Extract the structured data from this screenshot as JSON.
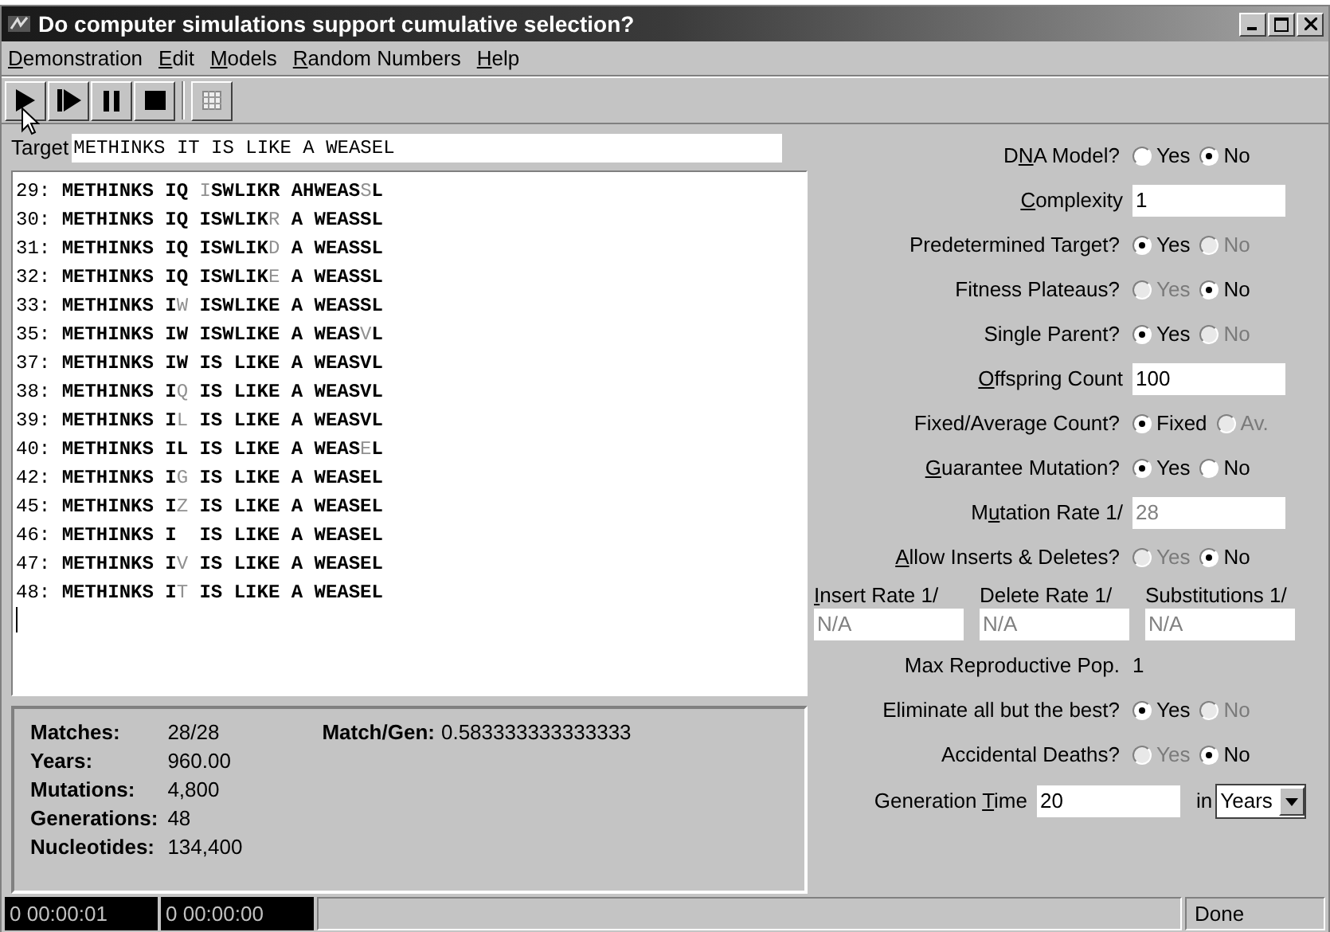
{
  "window": {
    "title": "Do computer simulations support cumulative selection?"
  },
  "menu": [
    {
      "label": [
        {
          "text": "D",
          "underline": true
        },
        {
          "text": "emonstration",
          "underline": false
        }
      ]
    },
    {
      "label": [
        {
          "text": "E",
          "underline": true
        },
        {
          "text": "dit",
          "underline": false
        }
      ]
    },
    {
      "label": [
        {
          "text": "M",
          "underline": true
        },
        {
          "text": "odels",
          "underline": false
        }
      ]
    },
    {
      "label": [
        {
          "text": "R",
          "underline": true
        },
        {
          "text": "andom Numbers",
          "underline": false
        }
      ]
    },
    {
      "label": [
        {
          "text": "H",
          "underline": true
        },
        {
          "text": "elp",
          "underline": false
        }
      ]
    }
  ],
  "toolbar": [
    {
      "kind": "play"
    },
    {
      "kind": "step"
    },
    {
      "kind": "pause"
    },
    {
      "kind": "stop"
    },
    {
      "kind": "grid"
    }
  ],
  "target": {
    "label": "Target",
    "value": "METHINKS IT IS LIKE A WEASEL"
  },
  "output": [
    {
      "number": "29:",
      "segments": [
        {
          "text": "METHINKS IQ ",
          "changed": false
        },
        {
          "text": "I",
          "changed": true
        },
        {
          "text": "SWLIKR AHWEAS",
          "changed": false
        },
        {
          "text": "S",
          "changed": true
        },
        {
          "text": "L",
          "changed": false
        }
      ]
    },
    {
      "number": "30:",
      "segments": [
        {
          "text": "METHINKS IQ ISWLIK",
          "changed": false
        },
        {
          "text": "R",
          "changed": true
        },
        {
          "text": " A WEASSL",
          "changed": false
        }
      ]
    },
    {
      "number": "31:",
      "segments": [
        {
          "text": "METHINKS IQ ISWLIK",
          "changed": false
        },
        {
          "text": "D",
          "changed": true
        },
        {
          "text": " A WEASSL",
          "changed": false
        }
      ]
    },
    {
      "number": "32:",
      "segments": [
        {
          "text": "METHINKS IQ ISWLIK",
          "changed": false
        },
        {
          "text": "E",
          "changed": true
        },
        {
          "text": " A WEASSL",
          "changed": false
        }
      ]
    },
    {
      "number": "33:",
      "segments": [
        {
          "text": "METHINKS I",
          "changed": false
        },
        {
          "text": "W",
          "changed": true
        },
        {
          "text": " ISWLIKE A WEASSL",
          "changed": false
        }
      ]
    },
    {
      "number": "35:",
      "segments": [
        {
          "text": "METHINKS IW ISWLIKE A WEAS",
          "changed": false
        },
        {
          "text": "V",
          "changed": true
        },
        {
          "text": "L",
          "changed": false
        }
      ]
    },
    {
      "number": "37:",
      "segments": [
        {
          "text": "METHINKS IW IS LIKE A WEASVL",
          "changed": false
        }
      ]
    },
    {
      "number": "38:",
      "segments": [
        {
          "text": "METHINKS I",
          "changed": false
        },
        {
          "text": "Q",
          "changed": true
        },
        {
          "text": " IS LIKE A WEASVL",
          "changed": false
        }
      ]
    },
    {
      "number": "39:",
      "segments": [
        {
          "text": "METHINKS I",
          "changed": false
        },
        {
          "text": "L",
          "changed": true
        },
        {
          "text": " IS LIKE A WEASVL",
          "changed": false
        }
      ]
    },
    {
      "number": "40:",
      "segments": [
        {
          "text": "METHINKS IL IS LIKE A WEAS",
          "changed": false
        },
        {
          "text": "E",
          "changed": true
        },
        {
          "text": "L",
          "changed": false
        }
      ]
    },
    {
      "number": "42:",
      "segments": [
        {
          "text": "METHINKS I",
          "changed": false
        },
        {
          "text": "G",
          "changed": true
        },
        {
          "text": " IS LIKE A WEASEL",
          "changed": false
        }
      ]
    },
    {
      "number": "45:",
      "segments": [
        {
          "text": "METHINKS I",
          "changed": false
        },
        {
          "text": "Z",
          "changed": true
        },
        {
          "text": " IS LIKE A WEASEL",
          "changed": false
        }
      ]
    },
    {
      "number": "46:",
      "segments": [
        {
          "text": "METHINKS I  IS LIKE A WEASEL",
          "changed": false
        }
      ]
    },
    {
      "number": "47:",
      "segments": [
        {
          "text": "METHINKS I",
          "changed": false
        },
        {
          "text": "V",
          "changed": true
        },
        {
          "text": " IS LIKE A WEASEL",
          "changed": false
        }
      ]
    },
    {
      "number": "48:",
      "segments": [
        {
          "text": "METHINKS I",
          "changed": false
        },
        {
          "text": "T",
          "changed": true
        },
        {
          "text": " IS LIKE A WEASEL",
          "changed": false
        }
      ]
    }
  ],
  "stats": [
    {
      "label": "Matches:",
      "value": "28/28"
    },
    {
      "label": "Years:",
      "value": "960.00"
    },
    {
      "label": "Mutations:",
      "value": "4,800"
    },
    {
      "label": "Generations:",
      "value": "48"
    },
    {
      "label": "Nucleotides:",
      "value": "134,400"
    }
  ],
  "match_per_gen": {
    "label": "Match/Gen:",
    "value": "0.583333333333333"
  },
  "settings": [
    {
      "kind": "radio",
      "label": [
        {
          "text": "D",
          "underline": false
        },
        {
          "text": "N",
          "underline": true
        },
        {
          "text": "A Model?",
          "underline": false
        }
      ],
      "options": [
        {
          "label": "Yes",
          "selected": false,
          "disabled": false
        },
        {
          "label": "No",
          "selected": true,
          "disabled": false
        }
      ]
    },
    {
      "kind": "field",
      "label": [
        {
          "text": "C",
          "underline": true
        },
        {
          "text": "omplexity",
          "underline": false
        }
      ],
      "value": "1",
      "disabled": false
    },
    {
      "kind": "radio",
      "label": "Predetermined Target?",
      "options": [
        {
          "label": "Yes",
          "selected": true,
          "disabled": false
        },
        {
          "label": "No",
          "selected": false,
          "disabled": true
        }
      ]
    },
    {
      "kind": "radio",
      "label": "Fitness Plateaus?",
      "options": [
        {
          "label": "Yes",
          "selected": false,
          "disabled": true
        },
        {
          "label": "No",
          "selected": true,
          "disabled": false
        }
      ]
    },
    {
      "kind": "radio",
      "label": "Single Parent?",
      "options": [
        {
          "label": "Yes",
          "selected": true,
          "disabled": false
        },
        {
          "label": "No",
          "selected": false,
          "disabled": true
        }
      ]
    },
    {
      "kind": "field",
      "label": [
        {
          "text": "O",
          "underline": true
        },
        {
          "text": "ffspring Count",
          "underline": false
        }
      ],
      "value": "100",
      "disabled": false
    },
    {
      "kind": "radio",
      "label": "Fixed/Average Count?",
      "options": [
        {
          "label": "Fixed",
          "selected": true,
          "disabled": false
        },
        {
          "label": "Av.",
          "selected": false,
          "disabled": true
        }
      ]
    },
    {
      "kind": "radio",
      "label": [
        {
          "text": "G",
          "underline": true
        },
        {
          "text": "uarantee Mutation?",
          "underline": false
        }
      ],
      "options": [
        {
          "label": "Yes",
          "selected": true,
          "disabled": false
        },
        {
          "label": "No",
          "selected": false,
          "disabled": false
        }
      ]
    },
    {
      "kind": "field",
      "label": [
        {
          "text": "M",
          "underline": false
        },
        {
          "text": "u",
          "underline": true
        },
        {
          "text": "tation Rate 1/",
          "underline": false
        }
      ],
      "value": "28",
      "disabled": true
    },
    {
      "kind": "radio",
      "label": [
        {
          "text": "A",
          "underline": true
        },
        {
          "text": "llow Inserts & Deletes?",
          "underline": false
        }
      ],
      "options": [
        {
          "label": "Yes",
          "selected": false,
          "disabled": true
        },
        {
          "label": "No",
          "selected": true,
          "disabled": false
        }
      ]
    },
    {
      "kind": "triple",
      "fields": [
        {
          "label": [
            {
              "text": "I",
              "underline": true
            },
            {
              "text": "nsert Rate 1/",
              "underline": false
            }
          ],
          "value": "N/A",
          "disabled": true
        },
        {
          "label": "Delete Rate 1/",
          "value": "N/A",
          "disabled": true
        },
        {
          "label": "Substitutions 1/",
          "value": "N/A",
          "disabled": true
        }
      ]
    },
    {
      "kind": "text",
      "label": "Max Reproductive Pop.",
      "value": "1"
    },
    {
      "kind": "radio",
      "label": "Eliminate all but the best?",
      "options": [
        {
          "label": "Yes",
          "selected": true,
          "disabled": false
        },
        {
          "label": "No",
          "selected": false,
          "disabled": true
        }
      ]
    },
    {
      "kind": "radio",
      "label": "Accidental Deaths?",
      "options": [
        {
          "label": "Yes",
          "selected": false,
          "disabled": true
        },
        {
          "label": "No",
          "selected": true,
          "disabled": false
        }
      ]
    },
    {
      "kind": "time",
      "label": [
        {
          "text": "Generation ",
          "underline": false
        },
        {
          "text": "T",
          "underline": true
        },
        {
          "text": "ime",
          "underline": false
        }
      ],
      "value": "20",
      "unit_label": "in",
      "unit": "Years"
    }
  ],
  "status_bar": {
    "timers": [
      "0 00:00:01",
      "0 00:00:00"
    ],
    "status": "Done"
  }
}
